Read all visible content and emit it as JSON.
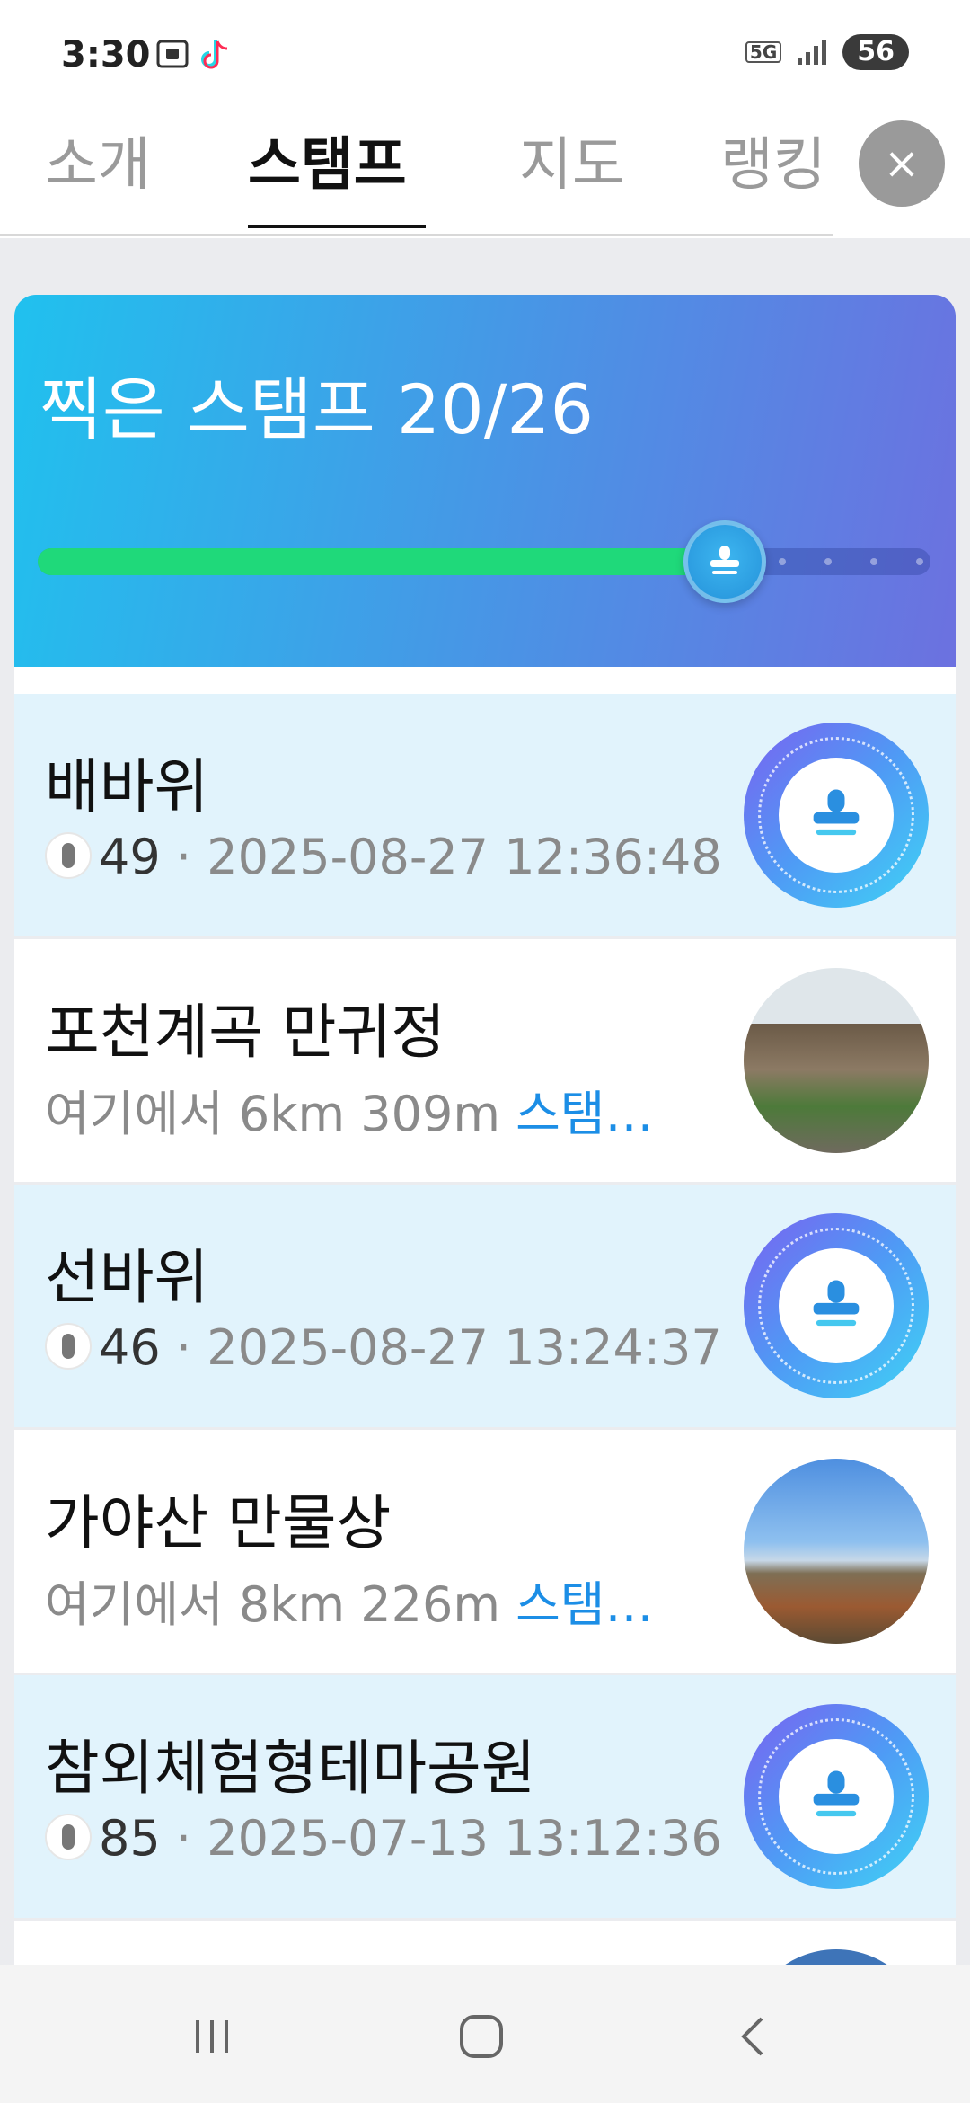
{
  "status_bar": {
    "time": "3:30",
    "network": "5G",
    "battery": "56"
  },
  "tabs": [
    {
      "label": "소개",
      "active": false
    },
    {
      "label": "스탬프",
      "active": true
    },
    {
      "label": "지도",
      "active": false
    },
    {
      "label": "랭킹",
      "active": false
    }
  ],
  "close_label": "×",
  "progress": {
    "title": "찍은 스탬프 20/26",
    "collected": 20,
    "total": 26,
    "fraction": 0.77,
    "fill_color": "#1fd97a"
  },
  "stamps": [
    {
      "name": "배바위",
      "stamped": true,
      "count": "49",
      "sep": " · ",
      "date": "2025-08-27 12:36:48"
    },
    {
      "name": "포천계곡 만귀정",
      "stamped": false,
      "distance": "여기에서 6km 309m ",
      "link": "스탬…",
      "photo": "house"
    },
    {
      "name": "선바위",
      "stamped": true,
      "count": "46",
      "sep": " · ",
      "date": "2025-08-27 13:24:37"
    },
    {
      "name": "가야산 만물상",
      "stamped": false,
      "distance": "여기에서 8km 226m ",
      "link": "스탬…",
      "photo": "mountain"
    },
    {
      "name": "참외체험형테마공원",
      "stamped": true,
      "count": "85",
      "sep": " · ",
      "date": "2025-07-13 13:12:36"
    }
  ],
  "colors": {
    "accent": "#1c8ee6",
    "stamped_bg": "#e1f3fc",
    "progress_fill": "#1fd97a"
  }
}
